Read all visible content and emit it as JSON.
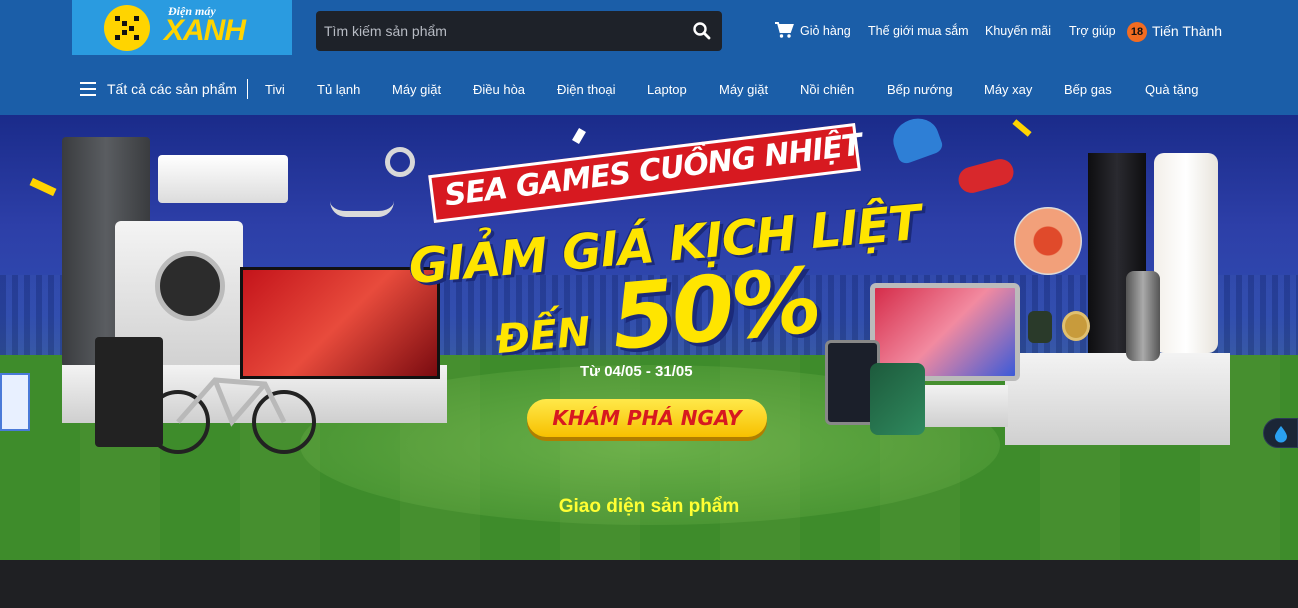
{
  "header": {
    "logo_top": "Điện máy",
    "logo_main": "XANH",
    "search_placeholder": "Tìm kiếm sản phẩm",
    "links": [
      "Giỏ hàng",
      "Thế giới mua sắm",
      "Khuyến mãi",
      "Trợ giúp"
    ],
    "user_badge": "18",
    "user_name": "Tiến Thành"
  },
  "nav": {
    "all_label": "Tất cả các sản phẩm",
    "items": [
      "Tivi",
      "Tủ lạnh",
      "Máy giặt",
      "Điều hòa",
      "Điện thoại",
      "Laptop",
      "Máy giặt",
      "Nồi chiên",
      "Bếp nướng",
      "Máy xay",
      "Bếp gas",
      "Quà tặng"
    ]
  },
  "banner": {
    "ribbon": "SEA GAMES CUỒNG NHIỆT",
    "headline1": "GIẢM GIÁ KỊCH LIỆT",
    "headline2_pre": "ĐẾN",
    "headline2_big": "50%",
    "date": "Từ 04/05 - 31/05",
    "cta": "KHÁM PHÁ NGAY",
    "caption": "Giao diện sản phẩm"
  },
  "colors": {
    "header_bg": "#1b5ea8",
    "logo_bg": "#2a9be0",
    "accent_yellow": "#ffe500",
    "ribbon_red": "#d71920",
    "badge_orange": "#f26c21"
  },
  "icons": {
    "cart": "cart-icon",
    "search": "search-icon",
    "menu": "hamburger-icon",
    "float": "water-drop-icon"
  }
}
